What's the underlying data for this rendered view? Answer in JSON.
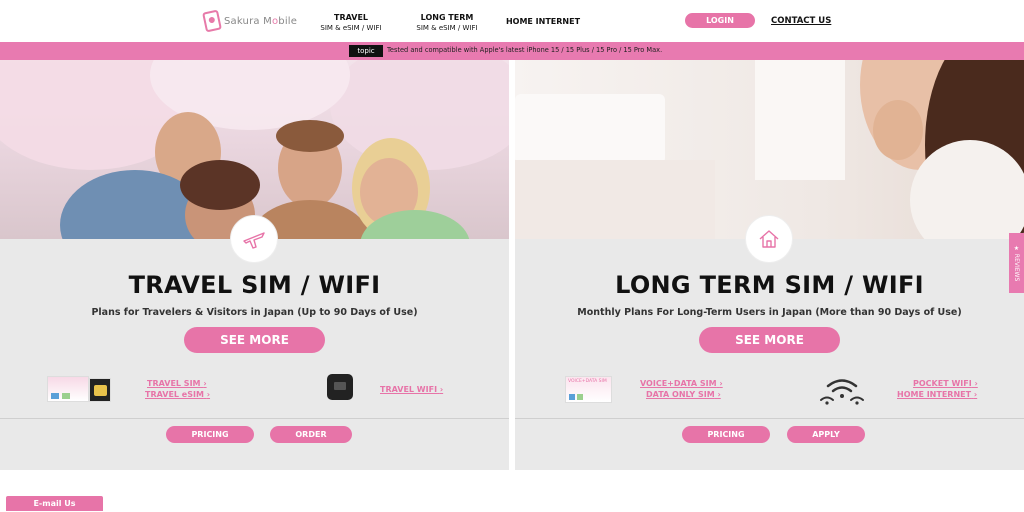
{
  "header": {
    "logo_text_a": "Sakura M",
    "logo_text_o": "o",
    "logo_text_b": "bile",
    "nav": [
      {
        "title": "TRAVEL",
        "sub": "SIM & eSIM / WIFI"
      },
      {
        "title": "LONG TERM",
        "sub": "SIM & eSIM / WIFI"
      },
      {
        "title": "HOME INTERNET",
        "sub": ""
      }
    ],
    "login_label": "LOGIN",
    "contact_label": "CONTACT US"
  },
  "topic": {
    "tag": "topic",
    "text": "Tested and compatible with Apple's latest iPhone 15 / 15 Plus / 15 Pro / 15 Pro Max."
  },
  "travel": {
    "icon": "airplane-icon",
    "title": "TRAVEL SIM / WIFI",
    "subtitle": "Plans for Travelers & Visitors in Japan (Up to 90 Days of Use)",
    "see_more": "SEE MORE",
    "links": [
      "TRAVEL SIM",
      "TRAVEL eSIM",
      "TRAVEL WIFI"
    ],
    "chevron": "›",
    "buttons": [
      "PRICING",
      "ORDER"
    ]
  },
  "long": {
    "icon": "house-icon",
    "title": "LONG TERM SIM / WIFI",
    "subtitle": "Monthly Plans For Long-Term Users in Japan (More than 90 Days of Use)",
    "see_more": "SEE MORE",
    "sim_card_label": "VOICE+DATA SIM",
    "links": [
      "VOICE+DATA SIM",
      "DATA ONLY SIM",
      "POCKET WIFI",
      "HOME INTERNET"
    ],
    "chevron": "›",
    "buttons": [
      "PRICING",
      "APPLY"
    ]
  },
  "reviews_tab": "★ REVIEWS",
  "email_button": "E-mail Us",
  "colors": {
    "accent": "#e774a8",
    "topic_bar": "#e87ab0",
    "panel_bg": "#e9e9e9"
  }
}
